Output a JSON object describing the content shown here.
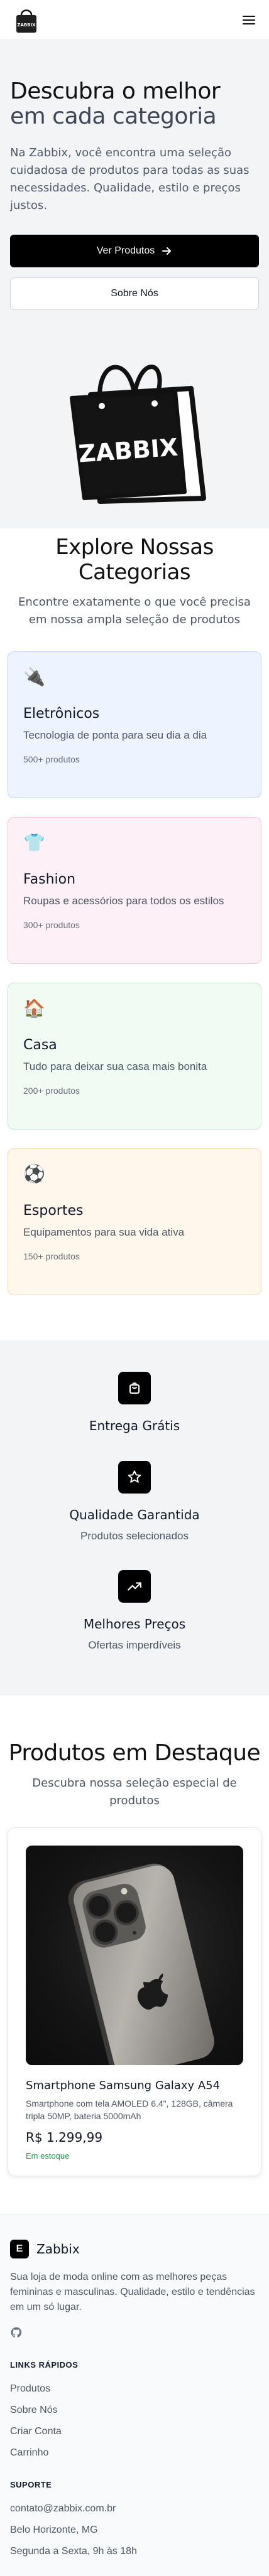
{
  "header": {
    "logo_text": "ZABBIX",
    "logo_icon": "shopping-bag-logo",
    "menu_icon": "hamburger-icon"
  },
  "hero": {
    "title_line1": "Descubra o melhor",
    "title_line2": "em cada categoria",
    "lead": "Na Zabbix, você encontra uma seleção cuidadosa de produtos para todas as suas necessidades. Qualidade, estilo e preços justos.",
    "primary_button": "Ver Produtos",
    "primary_button_icon": "arrow-right-icon",
    "secondary_button": "Sobre Nós",
    "image_text": "ZABBIX"
  },
  "categories": {
    "title": "Explore Nossas Categorias",
    "subtitle": "Encontre exatamente o que você precisa em nossa ampla seleção de produtos",
    "items": [
      {
        "icon": "🔌",
        "name": "Eletrônicos",
        "desc": "Tecnologia de ponta para seu dia a dia",
        "count": "500+ produtos",
        "bg": "#eef4ff",
        "border": "#bfd4fb"
      },
      {
        "icon": "👕",
        "name": "Fashion",
        "desc": "Roupas e acessórios para todos os estilos",
        "count": "300+ produtos",
        "bg": "#fdf1f7",
        "border": "#f6c6dc"
      },
      {
        "icon": "🏠",
        "name": "Casa",
        "desc": "Tudo para deixar sua casa mais bonita",
        "count": "200+ produtos",
        "bg": "#f0fbf3",
        "border": "#bfe8cb"
      },
      {
        "icon": "⚽",
        "name": "Esportes",
        "desc": "Equipamentos para sua vida ativa",
        "count": "150+ produtos",
        "bg": "#fff7ec",
        "border": "#f7d9ae"
      }
    ]
  },
  "features": [
    {
      "icon": "shopping-bag-icon",
      "title": "Entrega Grátis",
      "desc": ""
    },
    {
      "icon": "star-icon",
      "title": "Qualidade Garantida",
      "desc": "Produtos selecionados"
    },
    {
      "icon": "trending-up-icon",
      "title": "Melhores Preços",
      "desc": "Ofertas imperdíveis"
    }
  ],
  "featured": {
    "title": "Produtos em Destaque",
    "subtitle": "Descubra nossa seleção especial de produtos",
    "products": [
      {
        "name": "Smartphone Samsung Galaxy A54",
        "desc": "Smartphone com tela AMOLED 6.4\", 128GB, câmera tripla 50MP, bateria 5000mAh",
        "price": "R$ 1.299,99",
        "stock": "Em estoque"
      }
    ]
  },
  "footer": {
    "logo_letter": "E",
    "brand": "Zabbix",
    "about": "Sua loja de moda online com as melhores peças femininas e masculinas. Qualidade, estilo e tendências em um só lugar.",
    "social_icon": "github-icon",
    "links_heading": "LINKS RÁPIDOS",
    "links": [
      "Produtos",
      "Sobre Nós",
      "Criar Conta",
      "Carrinho"
    ],
    "support_heading": "SUPORTE",
    "support": [
      "contato@zabbix.com.br",
      "Belo Horizonte, MG",
      "Segunda a Sexta, 9h às 18h"
    ]
  }
}
